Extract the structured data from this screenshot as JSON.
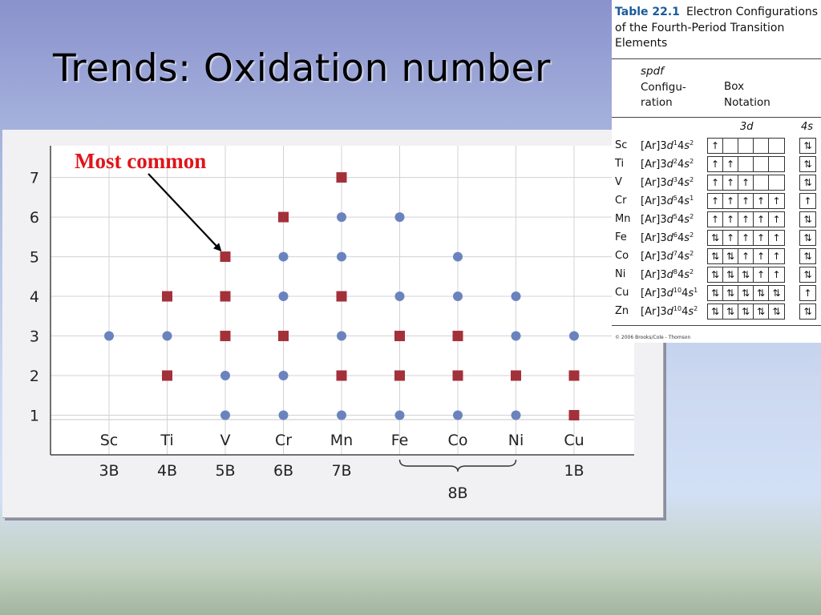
{
  "slide": {
    "title": "Trends: Oxidation number"
  },
  "chart_data": {
    "type": "scatter",
    "title": "",
    "xlabel": "",
    "ylabel": "",
    "ylim": [
      0,
      7.8
    ],
    "yticks": [
      1,
      2,
      3,
      4,
      5,
      6,
      7
    ],
    "grid": true,
    "categories": [
      "Sc",
      "Ti",
      "V",
      "Cr",
      "Mn",
      "Fe",
      "Co",
      "Ni",
      "Cu"
    ],
    "groups": [
      {
        "label": "3B",
        "span": [
          "Sc",
          "Sc"
        ]
      },
      {
        "label": "4B",
        "span": [
          "Ti",
          "Ti"
        ]
      },
      {
        "label": "5B",
        "span": [
          "V",
          "V"
        ]
      },
      {
        "label": "6B",
        "span": [
          "Cr",
          "Cr"
        ]
      },
      {
        "label": "7B",
        "span": [
          "Mn",
          "Mn"
        ]
      },
      {
        "label": "8B",
        "span": [
          "Fe",
          "Ni"
        ]
      },
      {
        "label": "1B",
        "span": [
          "Cu",
          "Cu"
        ]
      }
    ],
    "series": [
      {
        "marker": "circle",
        "color": "#6b83bd",
        "points": [
          [
            "Sc",
            3
          ],
          [
            "Ti",
            3
          ],
          [
            "V",
            1
          ],
          [
            "V",
            2
          ],
          [
            "Cr",
            1
          ],
          [
            "Cr",
            2
          ],
          [
            "Cr",
            4
          ],
          [
            "Cr",
            5
          ],
          [
            "Mn",
            1
          ],
          [
            "Mn",
            3
          ],
          [
            "Mn",
            5
          ],
          [
            "Mn",
            6
          ],
          [
            "Fe",
            1
          ],
          [
            "Fe",
            4
          ],
          [
            "Fe",
            6
          ],
          [
            "Co",
            1
          ],
          [
            "Co",
            4
          ],
          [
            "Co",
            5
          ],
          [
            "Ni",
            1
          ],
          [
            "Ni",
            3
          ],
          [
            "Ni",
            4
          ],
          [
            "Cu",
            3
          ]
        ]
      },
      {
        "marker": "square",
        "color": "#a3313a",
        "points": [
          [
            "Ti",
            2
          ],
          [
            "Ti",
            4
          ],
          [
            "V",
            3
          ],
          [
            "V",
            4
          ],
          [
            "V",
            5
          ],
          [
            "Cr",
            3
          ],
          [
            "Cr",
            6
          ],
          [
            "Mn",
            2
          ],
          [
            "Mn",
            4
          ],
          [
            "Mn",
            7
          ],
          [
            "Fe",
            2
          ],
          [
            "Fe",
            3
          ],
          [
            "Co",
            2
          ],
          [
            "Co",
            3
          ],
          [
            "Ni",
            2
          ],
          [
            "Cu",
            1
          ],
          [
            "Cu",
            2
          ]
        ]
      }
    ],
    "annotation": {
      "text": "Most common",
      "points_to": [
        "V",
        5
      ],
      "color": "#e0141a"
    }
  },
  "table": {
    "number": "Table 22.1",
    "title": "Electron Configurations of the Fourth-Period Transition Elements",
    "col_spdf_line1": "spdf",
    "col_spdf_line2": "Configu-",
    "col_spdf_line3": "ration",
    "col_box_line1": "Box",
    "col_box_line2": "Notation",
    "sub_3d": "3d",
    "sub_4s": "4s",
    "rows": [
      {
        "symbol": "Sc",
        "n3d": "1",
        "n4s": "2",
        "boxes_3d": [
          "↑",
          "",
          "",
          "",
          ""
        ],
        "box_4s": "⇅"
      },
      {
        "symbol": "Ti",
        "n3d": "2",
        "n4s": "2",
        "boxes_3d": [
          "↑",
          "↑",
          "",
          "",
          ""
        ],
        "box_4s": "⇅"
      },
      {
        "symbol": "V",
        "n3d": "3",
        "n4s": "2",
        "boxes_3d": [
          "↑",
          "↑",
          "↑",
          "",
          ""
        ],
        "box_4s": "⇅"
      },
      {
        "symbol": "Cr",
        "n3d": "5",
        "n4s": "1",
        "boxes_3d": [
          "↑",
          "↑",
          "↑",
          "↑",
          "↑"
        ],
        "box_4s": "↑"
      },
      {
        "symbol": "Mn",
        "n3d": "5",
        "n4s": "2",
        "boxes_3d": [
          "↑",
          "↑",
          "↑",
          "↑",
          "↑"
        ],
        "box_4s": "⇅"
      },
      {
        "symbol": "Fe",
        "n3d": "6",
        "n4s": "2",
        "boxes_3d": [
          "⇅",
          "↑",
          "↑",
          "↑",
          "↑"
        ],
        "box_4s": "⇅"
      },
      {
        "symbol": "Co",
        "n3d": "7",
        "n4s": "2",
        "boxes_3d": [
          "⇅",
          "⇅",
          "↑",
          "↑",
          "↑"
        ],
        "box_4s": "⇅"
      },
      {
        "symbol": "Ni",
        "n3d": "8",
        "n4s": "2",
        "boxes_3d": [
          "⇅",
          "⇅",
          "⇅",
          "↑",
          "↑"
        ],
        "box_4s": "⇅"
      },
      {
        "symbol": "Cu",
        "n3d": "10",
        "n4s": "1",
        "boxes_3d": [
          "⇅",
          "⇅",
          "⇅",
          "⇅",
          "⇅"
        ],
        "box_4s": "↑"
      },
      {
        "symbol": "Zn",
        "n3d": "10",
        "n4s": "2",
        "boxes_3d": [
          "⇅",
          "⇅",
          "⇅",
          "⇅",
          "⇅"
        ],
        "box_4s": "⇅"
      }
    ],
    "copyright": "© 2006 Brooks/Cole - Thomson"
  }
}
